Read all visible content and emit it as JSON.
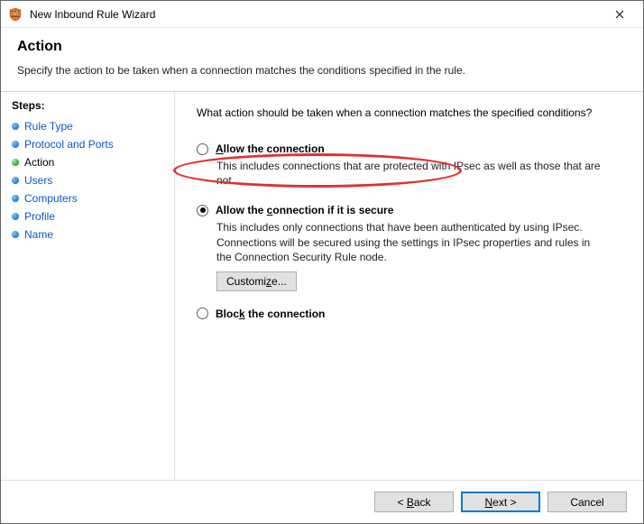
{
  "window": {
    "title": "New Inbound Rule Wizard"
  },
  "header": {
    "title": "Action",
    "subtitle": "Specify the action to be taken when a connection matches the conditions specified in the rule."
  },
  "sidebar": {
    "title": "Steps:",
    "items": [
      {
        "label": "Rule Type",
        "state": "link",
        "bulletClass": "blue"
      },
      {
        "label": "Protocol and Ports",
        "state": "link",
        "bulletClass": "blue"
      },
      {
        "label": "Action",
        "state": "current",
        "bulletClass": "green"
      },
      {
        "label": "Users",
        "state": "link",
        "bulletClass": "blue"
      },
      {
        "label": "Computers",
        "state": "link",
        "bulletClass": "blue"
      },
      {
        "label": "Profile",
        "state": "link",
        "bulletClass": "blue"
      },
      {
        "label": "Name",
        "state": "link",
        "bulletClass": "blue"
      }
    ]
  },
  "main": {
    "question": "What action should be taken when a connection matches the specified conditions?",
    "options": [
      {
        "id": "allow",
        "label_pre": "",
        "label_hot": "A",
        "label_post": "llow the connection",
        "desc": "This includes connections that are protected with IPsec as well as those that are not.",
        "checked": false
      },
      {
        "id": "allow-secure",
        "label_pre": "Allow the ",
        "label_hot": "c",
        "label_post": "onnection if it is secure",
        "desc": "This includes only connections that have been authenticated by using IPsec. Connections will be secured using the settings in IPsec properties and rules in the Connection Security Rule node.",
        "checked": true,
        "has_customize": true
      },
      {
        "id": "block",
        "label_pre": "Bloc",
        "label_hot": "k",
        "label_post": " the connection",
        "desc": "",
        "checked": false
      }
    ],
    "customize_label_pre": "Customi",
    "customize_label_hot": "z",
    "customize_label_post": "e..."
  },
  "footer": {
    "back_pre": "< ",
    "back_hot": "B",
    "back_post": "ack",
    "next_pre": "",
    "next_hot": "N",
    "next_post": "ext >",
    "cancel": "Cancel"
  }
}
